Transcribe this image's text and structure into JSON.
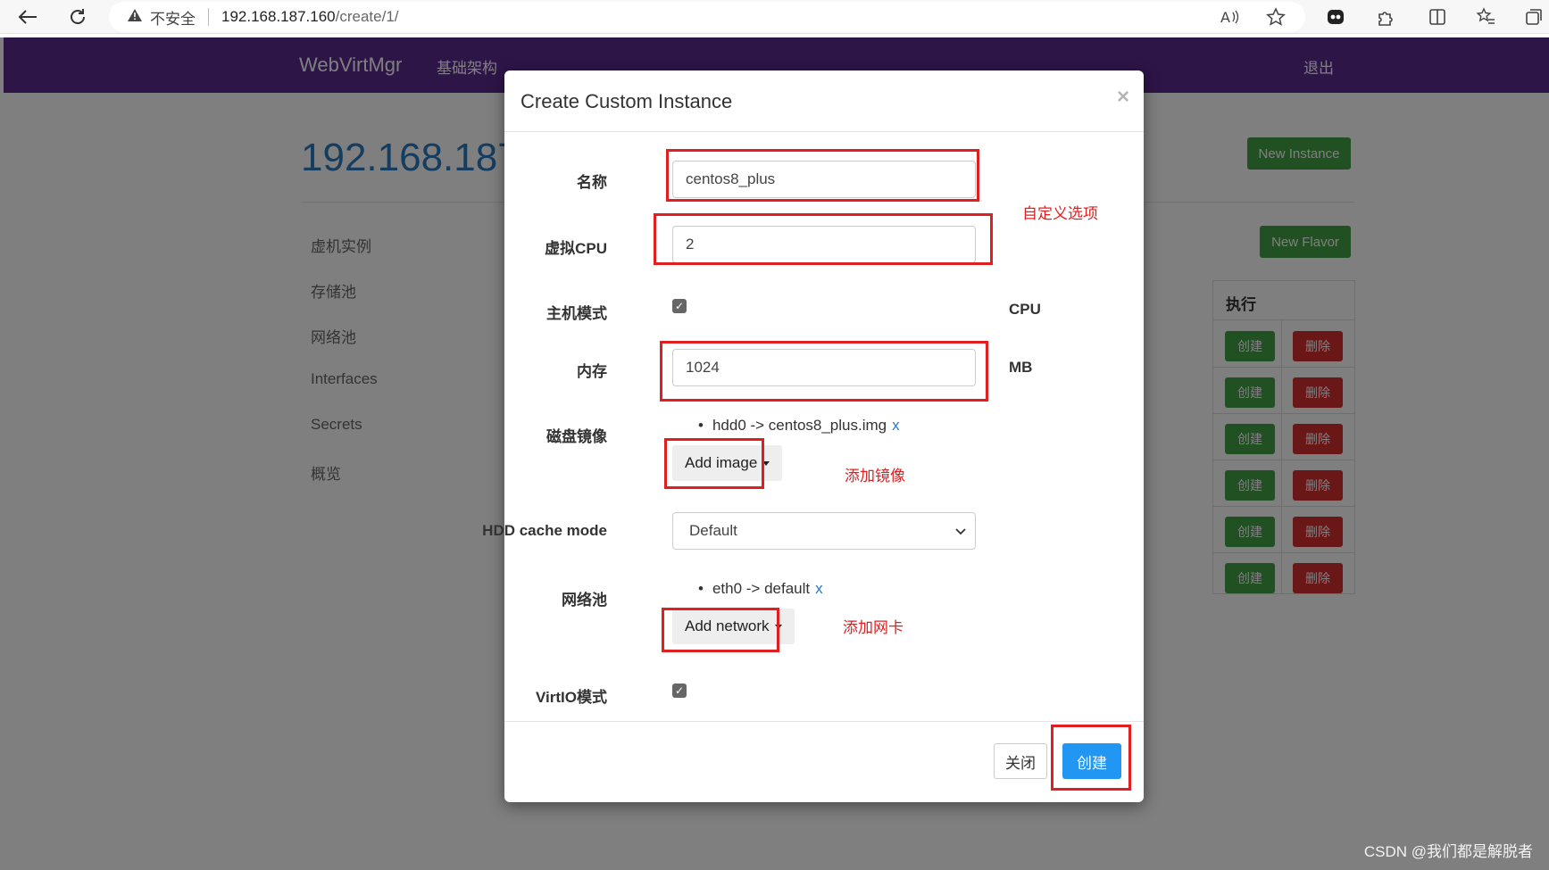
{
  "browser": {
    "warning": "不安全",
    "url_host": "192.168.187.160",
    "url_path": "/create/1/"
  },
  "topnav": {
    "brand": "WebVirtMgr",
    "infra": "基础架构",
    "logout": "退出"
  },
  "page": {
    "host_title": "192.168.187",
    "sidebar": [
      "虚机实例",
      "存储池",
      "网络池",
      "Interfaces",
      "Secrets",
      "概览"
    ],
    "new_instance": "New Instance",
    "new_flavor": "New Flavor",
    "table_header": "执行",
    "row_create": "创建",
    "row_delete": "删除"
  },
  "modal": {
    "title": "Create Custom Instance",
    "close_glyph": "×",
    "fields": {
      "name_label": "名称",
      "name_value": "centos8_plus",
      "vcpu_label": "虚拟CPU",
      "vcpu_value": "2",
      "host_mode_label": "主机模式",
      "host_mode_unit": "CPU",
      "memory_label": "内存",
      "memory_value": "1024",
      "memory_unit": "MB",
      "disk_label": "磁盘镜像",
      "disk_item": "hdd0 -> centos8_plus.img",
      "disk_remove": "x",
      "add_image": "Add image",
      "cache_label": "HDD cache mode",
      "cache_value": "Default",
      "network_label": "网络池",
      "network_item": "eth0 -> default",
      "network_remove": "x",
      "add_network": "Add network",
      "virtio_label": "VirtIO模式"
    },
    "footer": {
      "close": "关闭",
      "create": "创建"
    }
  },
  "annotations": {
    "custom_options": "自定义选项",
    "add_image": "添加镜像",
    "add_nic": "添加网卡"
  },
  "watermark": "CSDN @我们都是解脱者",
  "colors": {
    "nav_purple": "#5b2a91",
    "annotation_red": "#e02020",
    "primary_blue": "#2196f3",
    "success_green": "#43a047",
    "danger_red": "#d32f2f"
  }
}
